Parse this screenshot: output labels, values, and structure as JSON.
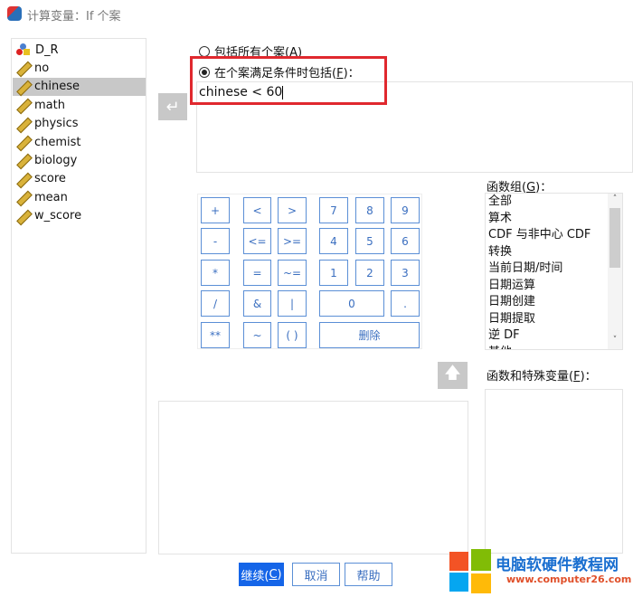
{
  "window": {
    "title": "计算变量：If 个案"
  },
  "variables": [
    {
      "name": "D_R",
      "type": "nominal"
    },
    {
      "name": "no",
      "type": "scale"
    },
    {
      "name": "chinese",
      "type": "scale",
      "selected": true
    },
    {
      "name": "math",
      "type": "scale"
    },
    {
      "name": "physics",
      "type": "scale"
    },
    {
      "name": "chemist",
      "type": "scale"
    },
    {
      "name": "biology",
      "type": "scale"
    },
    {
      "name": "score",
      "type": "scale"
    },
    {
      "name": "mean",
      "type": "scale"
    },
    {
      "name": "w_score",
      "type": "scale"
    }
  ],
  "options": {
    "all_cases": "包括所有个案(A)",
    "if_condition_pre": "在个案满足条件时包括(",
    "if_condition_key": "F",
    "if_condition_post": ")：",
    "selected": "if_condition"
  },
  "expression": "chinese < 60",
  "keypad": [
    "+",
    "<",
    ">",
    "7",
    "8",
    "9",
    "-",
    "<=",
    ">=",
    "4",
    "5",
    "6",
    "*",
    "=",
    "~=",
    "1",
    "2",
    "3",
    "/",
    "&",
    "|",
    "0",
    ".",
    "**",
    "~",
    "( )",
    "删除"
  ],
  "function_group": {
    "label_pre": "函数组(",
    "label_key": "G",
    "label_post": ")：",
    "items": [
      "全部",
      "算术",
      "CDF 与非中心 CDF",
      "转换",
      "当前日期/时间",
      "日期运算",
      "日期创建",
      "日期提取",
      "逆 DF",
      "其他"
    ]
  },
  "functions": {
    "label_pre": "函数和特殊变量(",
    "label_key": "F",
    "label_post": ")："
  },
  "buttons": {
    "continue_pre": "继续(",
    "continue_key": "C",
    "continue_post": ")",
    "cancel": "取消",
    "help": "帮助"
  },
  "watermark": {
    "title": "电脑软硬件教程网",
    "url": "www.computer26.com"
  }
}
